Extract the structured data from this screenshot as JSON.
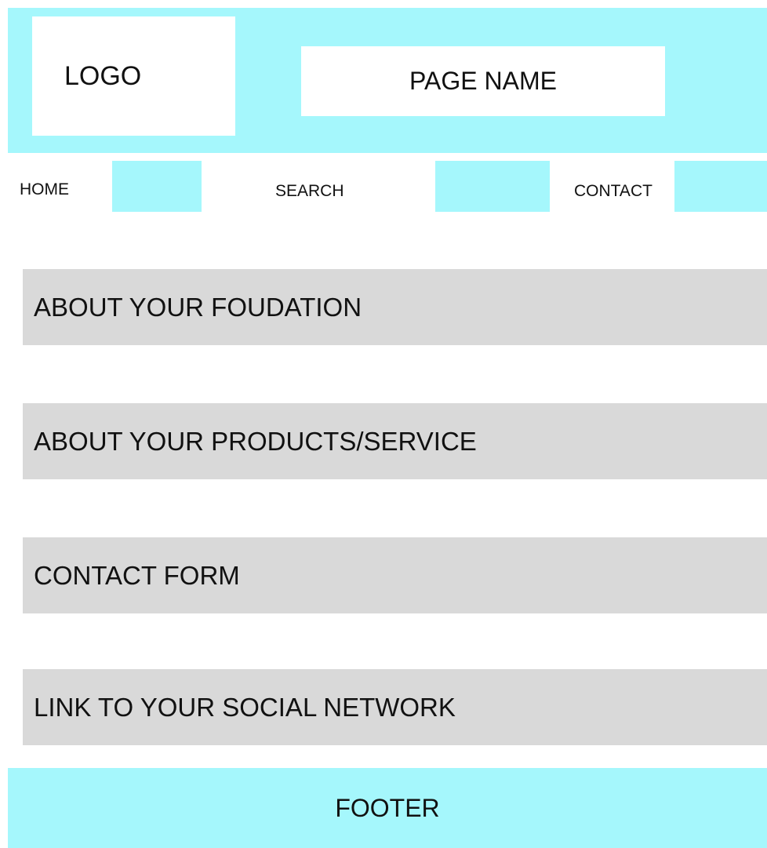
{
  "header": {
    "logo": "LOGO",
    "page_name": "PAGE NAME"
  },
  "nav": {
    "home": "HOME",
    "search": "SEARCH",
    "contact": "CONTACT"
  },
  "sections": [
    "ABOUT YOUR FOUDATION",
    "ABOUT YOUR PRODUCTS/SERVICE",
    "CONTACT FORM",
    "LINK TO YOUR SOCIAL NETWORK"
  ],
  "footer": {
    "label": "FOOTER"
  },
  "colors": {
    "accent": "#a5f7fc",
    "section_bg": "#d9d9d9",
    "box_bg": "#ffffff"
  }
}
